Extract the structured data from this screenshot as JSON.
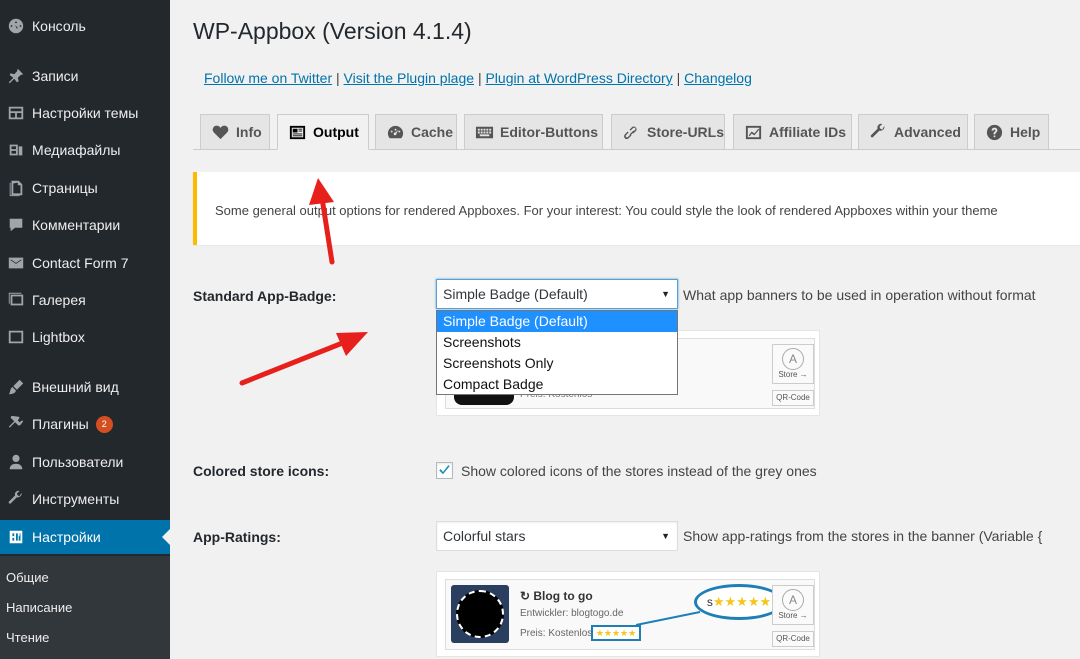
{
  "sidebar": {
    "items": [
      {
        "label": "Консоль",
        "icon": "dashboard-icon"
      },
      {
        "label": "Записи",
        "icon": "pin-icon"
      },
      {
        "label": "Настройки темы",
        "icon": "layout-icon"
      },
      {
        "label": "Медиафайлы",
        "icon": "media-icon"
      },
      {
        "label": "Страницы",
        "icon": "pages-icon"
      },
      {
        "label": "Комментарии",
        "icon": "comment-icon"
      },
      {
        "label": "Contact Form 7",
        "icon": "mail-icon"
      },
      {
        "label": "Галерея",
        "icon": "gallery-icon"
      },
      {
        "label": "Lightbox",
        "icon": "lightbox-icon"
      },
      {
        "label": "Внешний вид",
        "icon": "brush-icon"
      },
      {
        "label": "Плагины",
        "icon": "plugin-icon",
        "badge": "2"
      },
      {
        "label": "Пользователи",
        "icon": "users-icon"
      },
      {
        "label": "Инструменты",
        "icon": "wrench-icon"
      },
      {
        "label": "Настройки",
        "icon": "settings-icon",
        "active": true
      }
    ],
    "submenu": [
      "Общие",
      "Написание",
      "Чтение"
    ]
  },
  "page": {
    "title": "WP-Appbox (Version 4.1.4)",
    "links": [
      "Follow me on Twitter",
      "Visit the Plugin plage",
      "Plugin at WordPress Directory",
      "Changelog"
    ],
    "link_separator": "|"
  },
  "tabs": [
    {
      "label": "Info",
      "icon": "heart-icon"
    },
    {
      "label": "Output",
      "icon": "output-icon",
      "active": true
    },
    {
      "label": "Cache",
      "icon": "gauge-icon"
    },
    {
      "label": "Editor-Buttons",
      "icon": "keyboard-icon"
    },
    {
      "label": "Store-URLs",
      "icon": "link-icon"
    },
    {
      "label": "Affiliate IDs",
      "icon": "chart-icon"
    },
    {
      "label": "Advanced",
      "icon": "wrench-icon"
    },
    {
      "label": "Help",
      "icon": "help-icon"
    }
  ],
  "notice": "Some general output options for rendered Appboxes. For your interest: You could style the look of rendered Appboxes within your theme",
  "form": {
    "badge_label": "Standard App-Badge:",
    "badge_value": "Simple Badge (Default)",
    "badge_desc": "What app banners to be used in operation without format",
    "badge_options": [
      "Simple Badge (Default)",
      "Screenshots",
      "Screenshots Only",
      "Compact Badge"
    ],
    "colored_label": "Colored store icons:",
    "colored_checked": true,
    "colored_desc": "Show colored icons of the stores instead of the grey ones",
    "ratings_label": "App-Ratings:",
    "ratings_value": "Colorful stars",
    "ratings_desc": "Show app-ratings from the stores in the banner (Variable {"
  },
  "preview1": {
    "price_text": "Preis: Kostenlos",
    "store_label": "Store →",
    "qr_label": "QR-Code"
  },
  "preview2": {
    "app_name": "↻ Blog to go",
    "developer": "Entwickler: blogtogo.de",
    "price": "Preis: Kostenlos",
    "stars": "★★★★★",
    "stars_big": "★★★★★",
    "store_label": "Store →",
    "qr_label": "QR-Code",
    "prefix": "s"
  },
  "colors": {
    "sidebar_bg": "#23282d",
    "active_blue": "#0073aa",
    "notice_border": "#ffb900",
    "arrow_red": "#e8201c",
    "star_gold": "#f5c518"
  }
}
